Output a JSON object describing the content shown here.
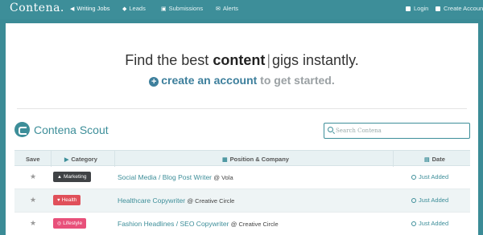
{
  "nav": {
    "brand": "Contena.",
    "items": [
      {
        "label": "Writing Jobs",
        "icon": "megaphone-icon"
      },
      {
        "label": "Leads",
        "icon": "graduation-cap-icon"
      },
      {
        "label": "Submissions",
        "icon": "inbox-icon"
      },
      {
        "label": "Alerts",
        "icon": "envelope-icon"
      }
    ],
    "login_label": "Login",
    "create_account_label": "Create Account"
  },
  "hero": {
    "title_prefix": "Find the best ",
    "title_bold": "content",
    "title_sep": "|",
    "title_suffix": "gigs instantly.",
    "plus_icon": "+",
    "cta_link": "create an account",
    "cta_rest": " to get started."
  },
  "scout": {
    "title": "Contena Scout",
    "search_placeholder": "Search Contena"
  },
  "table": {
    "headers": {
      "save": "Save",
      "category": "Category",
      "position": "Position & Company",
      "date": "Date"
    },
    "rows": [
      {
        "category": "Marketing",
        "category_icon": "thumbs-up-icon",
        "title": "Social Media / Blog Post Writer",
        "company": "@ Vola",
        "date": "Just Added"
      },
      {
        "category": "Health",
        "category_icon": "heart-icon",
        "title": "Healthcare Copywriter",
        "company": "@ Creative Circle",
        "date": "Just Added"
      },
      {
        "category": "Lifestyle",
        "category_icon": "bicycle-icon",
        "title": "Fashion Headlines / SEO Copywriter",
        "company": "@ Creative Circle",
        "date": "Just Added"
      }
    ]
  },
  "colors": {
    "brand_teal": "#3d8e99",
    "link_blue": "#3d7f9c",
    "marketing": "#3f4245",
    "health": "#e0505a",
    "lifestyle": "#e8507a"
  }
}
